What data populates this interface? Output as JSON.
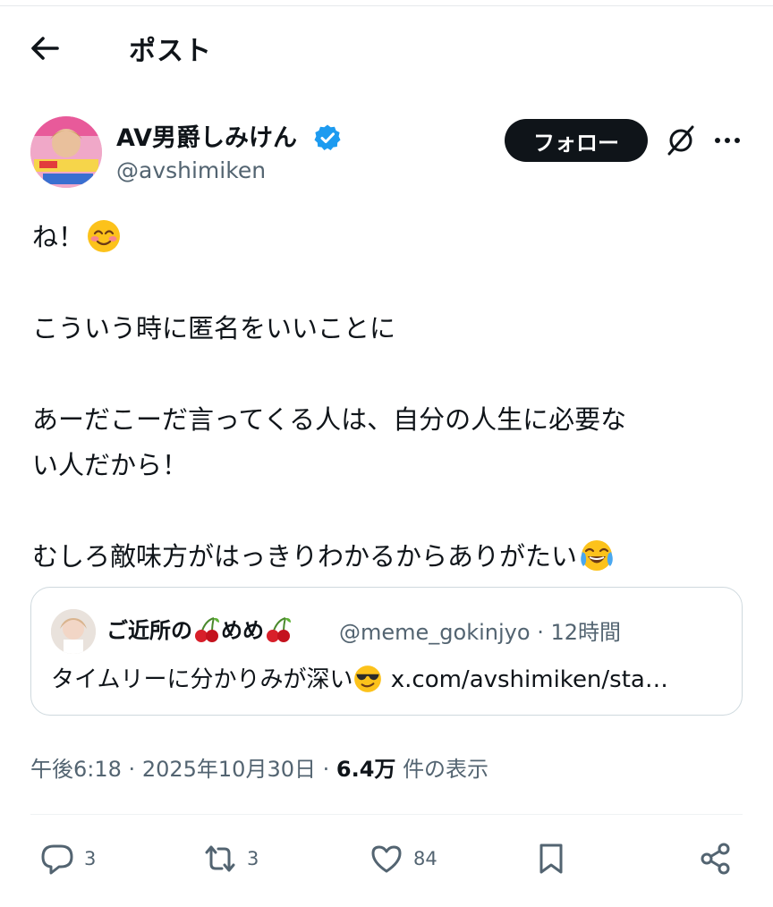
{
  "header": {
    "title": "ポスト"
  },
  "author": {
    "name": "AV男爵しみけん",
    "handle": "@avshimiken",
    "verified_color": "#1d9bf0"
  },
  "follow_label": "フォロー",
  "post": {
    "lines": [
      "ね！",
      "こういう時に匿名をいいことに",
      "あーだこーだ言ってくる人は、自分の人生に必要な",
      "い人だから！",
      "むしろ敵味方がはっきりわかるからありがたい"
    ],
    "emojis": [
      "smiling-face-with-blush",
      "face-with-tears-of-joy"
    ]
  },
  "quote": {
    "name_part1": "ご近所の",
    "name_part2": "めめ",
    "handle": "@meme_gokinjyo",
    "separator": "·",
    "time": "12時間",
    "text": "タイムリーに分かりみが深い",
    "link": "x.com/avshimiken/sta…",
    "emoji": "smiling-face-with-sunglasses"
  },
  "meta": {
    "time": "午後6:18",
    "sep1": "·",
    "date": "2025年10月30日",
    "sep2": "·",
    "views": "6.4万",
    "views_label": "件の表示"
  },
  "actions": {
    "replies": "3",
    "reposts": "3",
    "likes": "84"
  },
  "colors": {
    "text": "#0f1419",
    "secondary": "#536471",
    "border": "#cfd9de",
    "accent": "#1d9bf0"
  }
}
